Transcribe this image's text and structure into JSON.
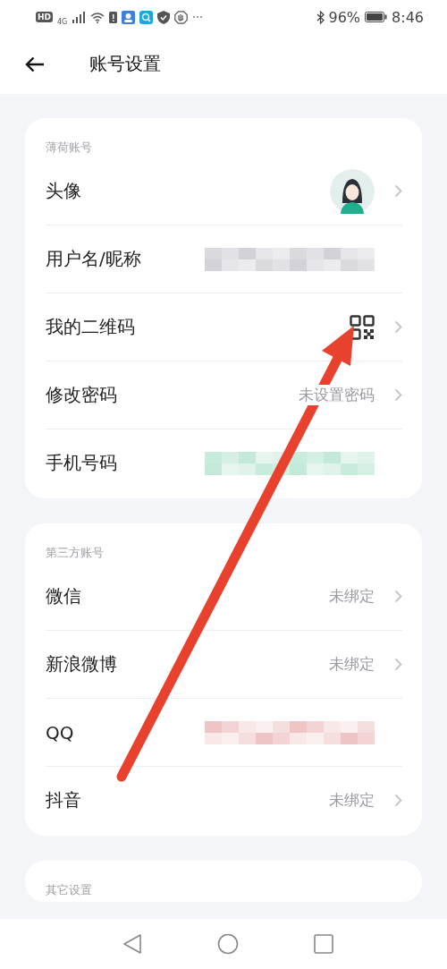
{
  "status_bar": {
    "left_labels": [
      "HD",
      "4G"
    ],
    "battery": "96%",
    "time": "8:46"
  },
  "header": {
    "title": "账号设置"
  },
  "sections": [
    {
      "title": "薄荷账号",
      "rows": [
        {
          "label": "头像",
          "kind": "avatar",
          "chevron": true
        },
        {
          "label": "用户名/昵称",
          "kind": "blurred",
          "chevron": false
        },
        {
          "label": "我的二维码",
          "kind": "qr",
          "chevron": true
        },
        {
          "label": "修改密码",
          "kind": "text",
          "value": "未设置密码",
          "chevron": true
        },
        {
          "label": "手机号码",
          "kind": "blurred-green",
          "chevron": false
        }
      ]
    },
    {
      "title": "第三方账号",
      "rows": [
        {
          "label": "微信",
          "kind": "text",
          "value": "未绑定",
          "chevron": true
        },
        {
          "label": "新浪微博",
          "kind": "text",
          "value": "未绑定",
          "chevron": true
        },
        {
          "label": "QQ",
          "kind": "blurred-red",
          "chevron": false
        },
        {
          "label": "抖音",
          "kind": "text",
          "value": "未绑定",
          "chevron": true
        }
      ]
    },
    {
      "title": "其它设置"
    }
  ]
}
